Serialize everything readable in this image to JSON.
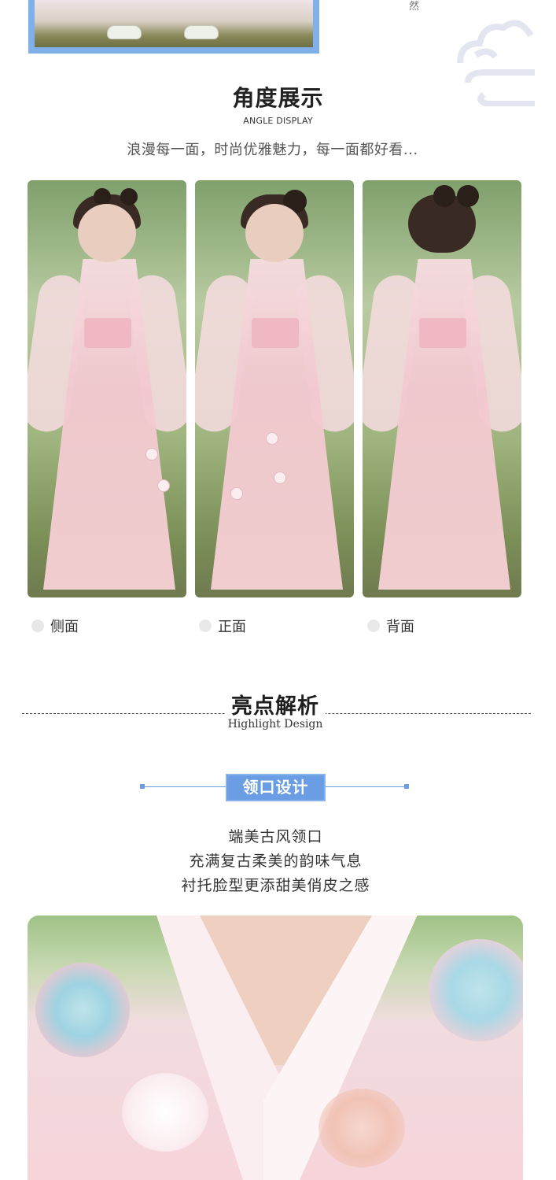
{
  "top": {
    "glyph": "然"
  },
  "angle_section": {
    "title": "角度展示",
    "subtitle": "ANGLE DISPLAY",
    "tagline": "浪漫每一面，时尚优雅魅力，每一面都好看...",
    "views": [
      {
        "label": "侧面"
      },
      {
        "label": "正面"
      },
      {
        "label": "背面"
      }
    ]
  },
  "highlight_section": {
    "title": "亮点解析",
    "subtitle": "Highlight Design",
    "feature_badge": "领口设计",
    "description": [
      "端美古风领口",
      "充满复古柔美的韵味气息",
      "衬托脸型更添甜美俏皮之感"
    ]
  },
  "colors": {
    "accent_blue": "#6a9de4",
    "dress_pink": "#f2c8cf"
  }
}
